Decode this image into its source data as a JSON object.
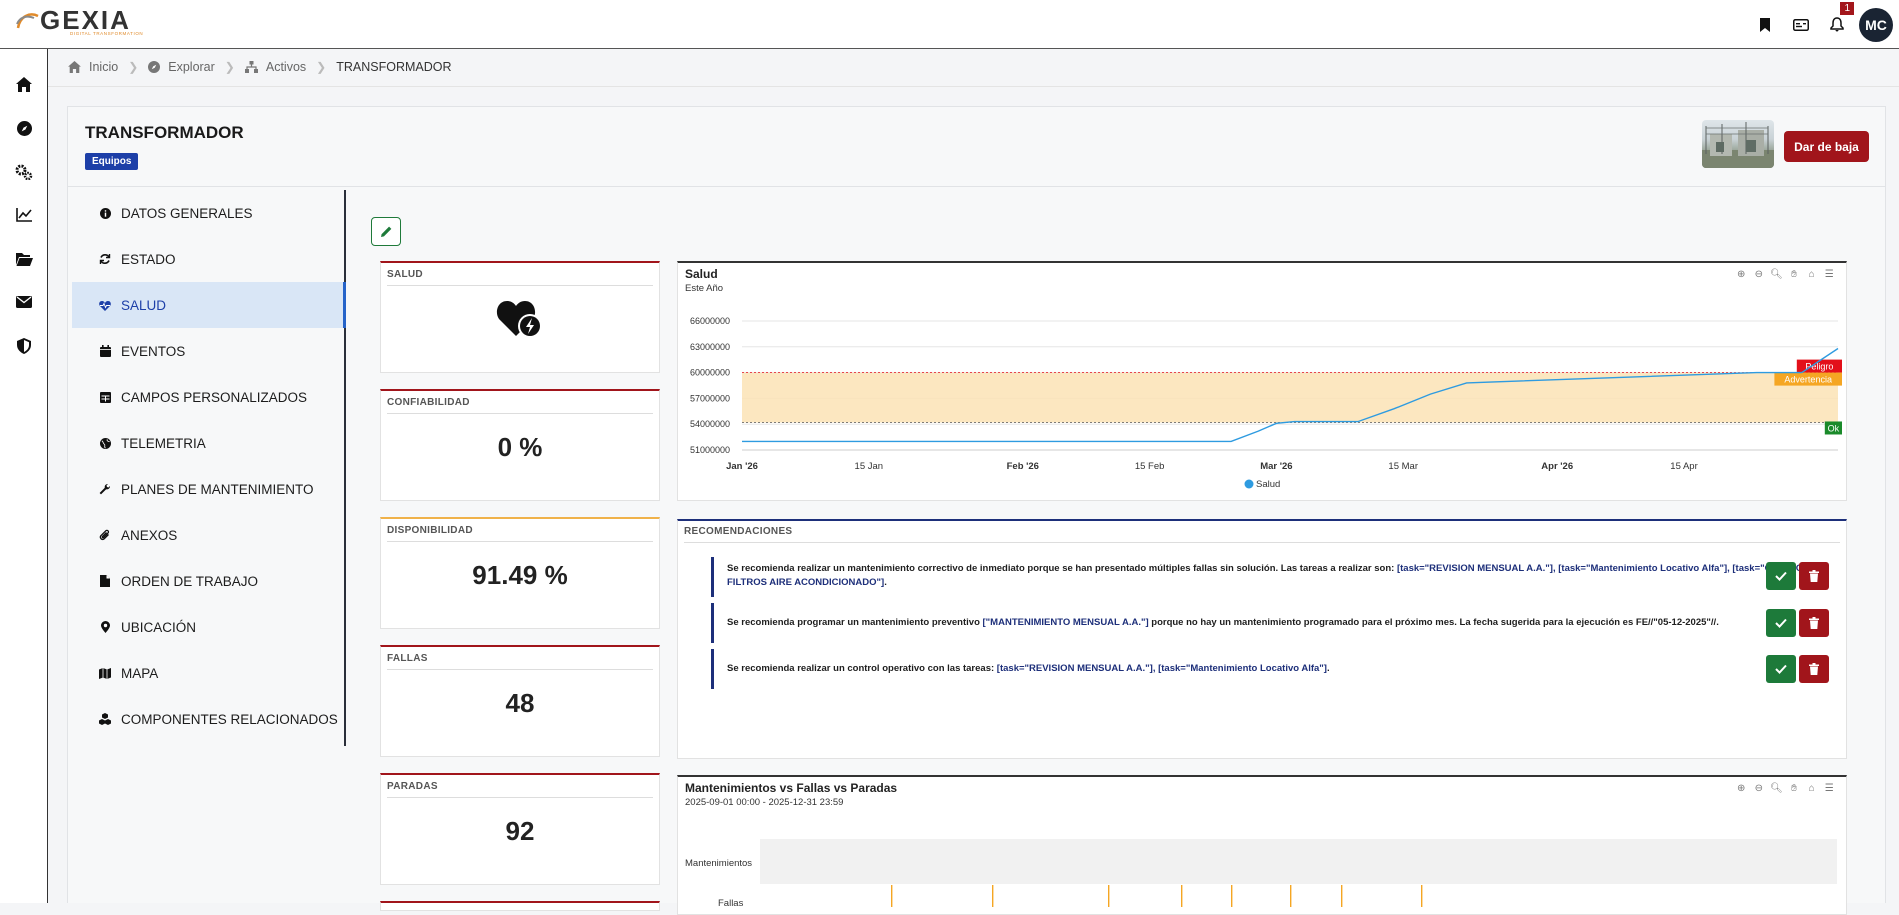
{
  "topbar": {
    "logo_text": "GEXIA",
    "logo_tagline": "DIGITAL TRANSFORMATION",
    "notification_count": "1",
    "avatar_initials": "MC"
  },
  "breadcrumb": {
    "home": "Inicio",
    "explore": "Explorar",
    "assets": "Activos",
    "current": "TRANSFORMADOR"
  },
  "asset": {
    "title": "TRANSFORMADOR",
    "badge": "Equipos",
    "decommission_button": "Dar de baja"
  },
  "menu": {
    "items": [
      {
        "label": "DATOS GENERALES",
        "icon": "info-icon"
      },
      {
        "label": "ESTADO",
        "icon": "refresh-icon"
      },
      {
        "label": "SALUD",
        "icon": "heartbeat-icon"
      },
      {
        "label": "EVENTOS",
        "icon": "calendar-icon"
      },
      {
        "label": "CAMPOS PERSONALIZADOS",
        "icon": "table-icon"
      },
      {
        "label": "TELEMETRIA",
        "icon": "globe-icon"
      },
      {
        "label": "PLANES DE MANTENIMIENTO",
        "icon": "wrench-icon"
      },
      {
        "label": "ANEXOS",
        "icon": "paperclip-icon"
      },
      {
        "label": "ORDEN DE TRABAJO",
        "icon": "file-icon"
      },
      {
        "label": "UBICACIÓN",
        "icon": "map-pin-icon"
      },
      {
        "label": "MAPA",
        "icon": "map-icon"
      },
      {
        "label": "COMPONENTES RELACIONADOS",
        "icon": "cubes-icon"
      }
    ],
    "active_index": 2
  },
  "kpis": {
    "salud_label": "SALUD",
    "confiabilidad_label": "CONFIABILIDAD",
    "confiabilidad_value": "0 %",
    "disponibilidad_label": "DISPONIBILIDAD",
    "disponibilidad_value": "91.49 %",
    "fallas_label": "FALLAS",
    "fallas_value": "48",
    "paradas_label": "PARADAS",
    "paradas_value": "92"
  },
  "health_chart": {
    "title": "Salud",
    "subtitle": "Este Año",
    "legend": "Salud",
    "band_labels": {
      "danger": "Peligro",
      "warning": "Advertencia",
      "ok": "Ok"
    },
    "colors": {
      "line": "#2e9be0",
      "band": "#fbe3b5",
      "danger": "#e3101a",
      "warning": "#f5a623",
      "ok": "#1a8a2a"
    }
  },
  "chart_data": [
    {
      "type": "line",
      "title": "Salud",
      "subtitle": "Este Año",
      "x_tick_labels": [
        "Jan '26",
        "15 Jan",
        "Feb '26",
        "15 Feb",
        "Mar '26",
        "15 Mar",
        "Apr '26",
        "15 Apr"
      ],
      "y_tick_labels": [
        "51000000",
        "54000000",
        "57000000",
        "60000000",
        "63000000",
        "66000000"
      ],
      "ylim": [
        51000000,
        66000000
      ],
      "thresholds": {
        "Peligro": 60000000,
        "Advertencia": 60000000,
        "Ok": 54200000
      },
      "series": [
        {
          "name": "Salud",
          "x": [
            "2026-01-01",
            "2026-02-24",
            "2026-02-27",
            "2026-03-01",
            "2026-03-03",
            "2026-03-10",
            "2026-03-14",
            "2026-03-18",
            "2026-03-22",
            "2026-04-23",
            "2026-04-28"
          ],
          "values": [
            52000000,
            52000000,
            53200000,
            54100000,
            54300000,
            54300000,
            55800000,
            57500000,
            58800000,
            60000000,
            60000000
          ]
        },
        {
          "name": "Salud (tramo final)",
          "x": [
            "2026-04-28",
            "2026-05-02"
          ],
          "values": [
            60000000,
            62800000
          ]
        }
      ],
      "legend": [
        "Salud"
      ]
    },
    {
      "type": "timeline",
      "title": "Mantenimientos vs Fallas vs Paradas",
      "subtitle": "2025-09-01 00:00 - 2025-12-31 23:59",
      "rows": [
        "Mantenimientos",
        "Fallas"
      ]
    }
  ],
  "recommendations": {
    "title": "RECOMENDACIONES",
    "items": [
      {
        "text_a": "Se recomienda realizar un mantenimiento correctivo de inmediato porque se han presentado múltiples fallas sin solución. Las tareas a realizar son: ",
        "tasks": "[task=\"REVISION MENSUAL A.A.\"], [task=\"Mantenimiento Locativo Alfa\"], [task=\"CAMBIO FILTROS AIRE ACONDICIONADO\"]",
        "text_b": "."
      },
      {
        "text_a": "Se recomienda programar un mantenimiento preventivo ",
        "tasks": "[\"MANTENIMIENTO MENSUAL A.A.\"]",
        "text_b": " porque no hay un mantenimiento programado para el próximo mes. La fecha sugerida para la ejecución es FE//\"05-12-2025\"//."
      },
      {
        "text_a": "Se recomienda realizar un control operativo con las tareas: ",
        "tasks": "[task=\"REVISION MENSUAL A.A.\"], [task=\"Mantenimiento Locativo Alfa\"]",
        "text_b": "."
      }
    ]
  },
  "timeline_chart": {
    "title": "Mantenimientos vs Fallas vs Paradas",
    "subtitle": "2025-09-01 00:00 - 2025-12-31 23:59",
    "row_maintenance": "Mantenimientos",
    "row_failures": "Fallas"
  }
}
